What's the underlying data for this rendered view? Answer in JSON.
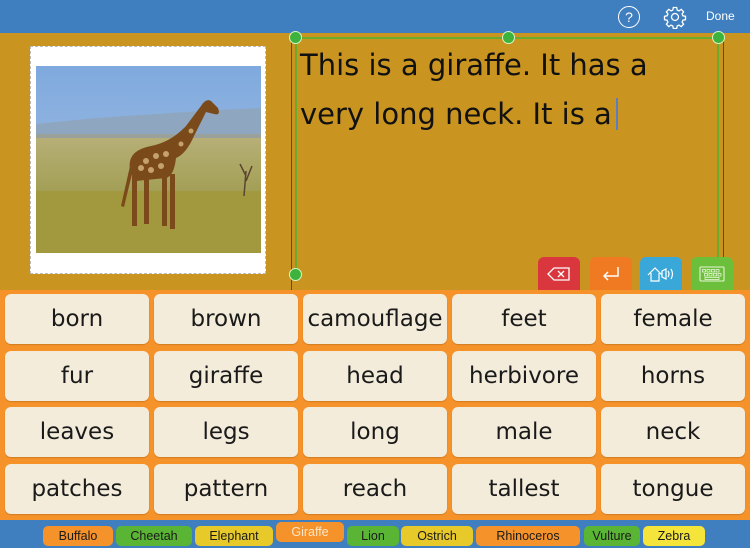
{
  "topbar": {
    "help_icon": "question-circle-icon",
    "settings_icon": "gear-icon",
    "done_label": "Done"
  },
  "photo": {
    "subject": "giraffe walking on savanna",
    "icon": "giraffe-photo"
  },
  "textbox": {
    "line1": "This is a giraffe. It has a",
    "line2": "very long neck. It is a"
  },
  "actions": [
    {
      "name": "delete",
      "icon": "backspace-icon",
      "color": "#d9363e"
    },
    {
      "name": "return",
      "icon": "return-arrow-icon",
      "color": "#f07a22"
    },
    {
      "name": "speak",
      "icon": "speaker-icon",
      "color": "#3aa7d9"
    },
    {
      "name": "keyboard",
      "icon": "keyboard-icon",
      "color": "#6bbf3a"
    }
  ],
  "words": [
    [
      "born",
      "brown",
      "camouflage",
      "feet",
      "female"
    ],
    [
      "fur",
      "giraffe",
      "head",
      "herbivore",
      "horns"
    ],
    [
      "leaves",
      "legs",
      "long",
      "male",
      "neck"
    ],
    [
      "patches",
      "pattern",
      "reach",
      "tallest",
      "tongue"
    ]
  ],
  "tabs": [
    {
      "label": "Buffalo",
      "color": "#f5922a",
      "active": false
    },
    {
      "label": "Cheetah",
      "color": "#5ab534",
      "active": false
    },
    {
      "label": "Elephant",
      "color": "#e8c92a",
      "active": false
    },
    {
      "label": "Giraffe",
      "color": "#f5922a",
      "active": true
    },
    {
      "label": "Lion",
      "color": "#5ab534",
      "active": false
    },
    {
      "label": "Ostrich",
      "color": "#e8c92a",
      "active": false
    },
    {
      "label": "Rhinoceros",
      "color": "#f5922a",
      "active": false
    },
    {
      "label": "Vulture",
      "color": "#5ab534",
      "active": false
    },
    {
      "label": "Zebra",
      "color": "#f5e53a",
      "active": false
    }
  ],
  "colors": {
    "topbar": "#3f7fbf",
    "background": "#c99420",
    "grid": "#f5922a",
    "word_tile": "#f3ecda",
    "selection": "#6aab2b"
  }
}
